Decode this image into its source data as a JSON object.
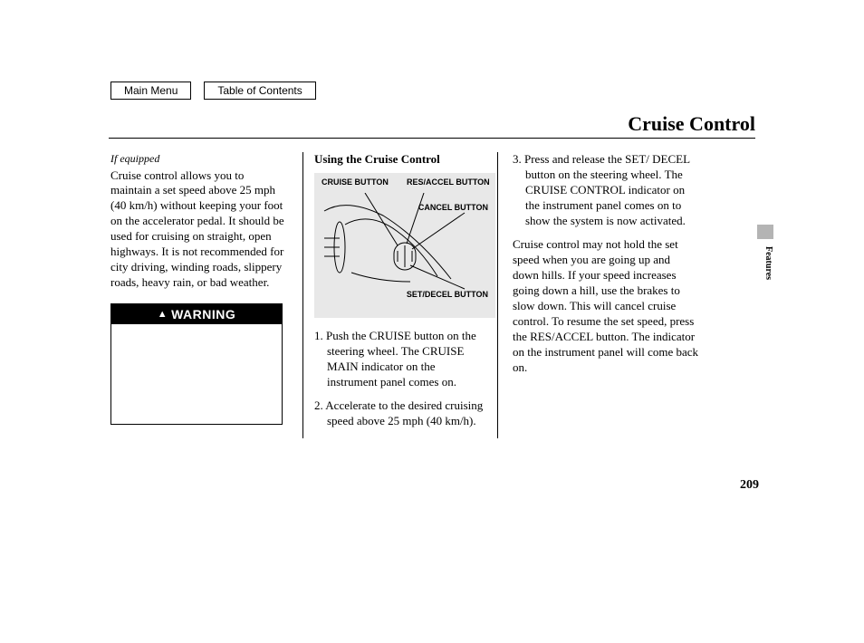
{
  "nav": {
    "main_menu": "Main Menu",
    "toc": "Table of Contents"
  },
  "title": "Cruise Control",
  "section_tab": "Features",
  "page_number": "209",
  "col1": {
    "if_equipped": "If equipped",
    "intro": "Cruise control allows you to maintain a set speed above 25 mph (40 km/h) without keeping your foot on the accelerator pedal. It should be used for cruising on straight, open highways. It is not recommended for city driving, winding roads, slippery roads, heavy rain, or bad weather.",
    "warning_label": "WARNING"
  },
  "col2": {
    "heading": "Using the Cruise Control",
    "diagram": {
      "cruise_button": "CRUISE BUTTON",
      "res_accel_button": "RES/ACCEL BUTTON",
      "cancel_button": "CANCEL BUTTON",
      "set_decel_button": "SET/DECEL BUTTON"
    },
    "step1": "1. Push the CRUISE button on the steering wheel. The CRUISE MAIN indicator on the instrument panel comes on.",
    "step2": "2. Accelerate to the desired cruising speed above 25 mph (40 km/h)."
  },
  "col3": {
    "step3": "3. Press and release the SET/ DECEL button on the steering wheel. The CRUISE CONTROL indicator on the instrument panel comes on to show the system is now activated.",
    "para2": "Cruise control may not hold the set speed when you are going up and down hills. If your speed increases going down a hill, use the brakes to slow down. This will cancel cruise control. To resume the set speed, press the RES/ACCEL button. The indicator on the instrument panel will come back on."
  }
}
